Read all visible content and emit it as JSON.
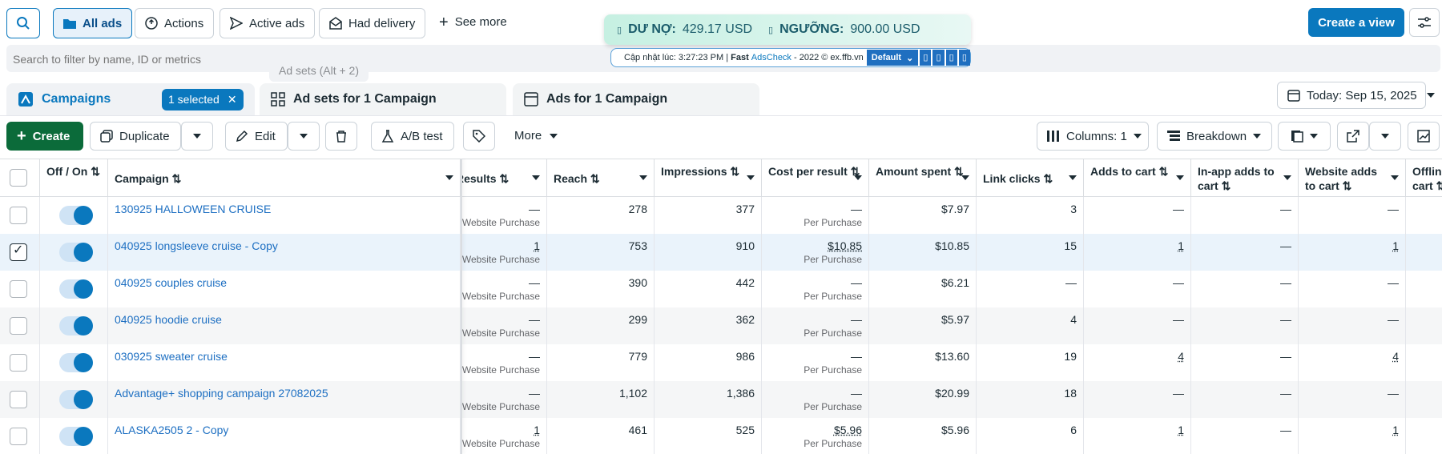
{
  "toolbar": {
    "all_ads": "All ads",
    "actions": "Actions",
    "active_ads": "Active ads",
    "had_delivery": "Had delivery",
    "see_more": "See more",
    "create_view": "Create a view"
  },
  "search": {
    "placeholder": "Search to filter by name, ID or metrics"
  },
  "tooltip": "Ad sets (Alt + 2)",
  "adscheck": {
    "debt_label": "DƯ NỢ:",
    "debt_value": "429.17 USD",
    "threshold_label": "NGƯỠNG:",
    "threshold_value": "900.00 USD",
    "updated": "Cập nhật lúc: 3:27:23 PM | ",
    "fast": "Fast ",
    "brand": "AdsCheck",
    "footer": " - 2022 © ex.ffb.vn",
    "select": "Default"
  },
  "tabs": {
    "campaigns": "Campaigns",
    "selected": "1 selected",
    "adsets": "Ad sets for 1 Campaign",
    "ads": "Ads for 1 Campaign"
  },
  "date": "Today: Sep 15, 2025",
  "actions": {
    "create": "Create",
    "duplicate": "Duplicate",
    "edit": "Edit",
    "ab": "A/B test",
    "more": "More",
    "columns": "Columns: 1",
    "breakdown": "Breakdown"
  },
  "headers": {
    "offon": "Off / On ⇅",
    "campaign": "Campaign ⇅",
    "results": "Results ⇅",
    "reach": "Reach ⇅",
    "impressions": "Impressions ⇅",
    "cpr": "Cost per result ⇅",
    "amount": "Amount spent ⇅",
    "clicks": "Link clicks ⇅",
    "atc": "Adds to cart ⇅",
    "inapp": "In-app adds to cart ⇅",
    "web": "Website adds to cart ⇅",
    "offline": "Offline adds to cart ⇅"
  },
  "rows": [
    {
      "name": "130925 HALLOWEEN CRUISE",
      "results": "—",
      "rsub": "Website Purchase",
      "reach": "278",
      "imp": "377",
      "cpr": "—",
      "csub": "Per Purchase",
      "amount": "$7.97",
      "clicks": "3",
      "atc": "—",
      "inapp": "—",
      "web": "—"
    },
    {
      "name": "040925 longsleeve cruise - Copy",
      "results": "1",
      "rsub": "Website Purchase",
      "reach": "753",
      "imp": "910",
      "cpr": "$10.85",
      "csub": "Per Purchase",
      "amount": "$10.85",
      "clicks": "15",
      "atc": "1",
      "inapp": "—",
      "web": "1"
    },
    {
      "name": "040925 couples cruise",
      "results": "—",
      "rsub": "Website Purchase",
      "reach": "390",
      "imp": "442",
      "cpr": "—",
      "csub": "Per Purchase",
      "amount": "$6.21",
      "clicks": "—",
      "atc": "—",
      "inapp": "—",
      "web": "—"
    },
    {
      "name": "040925 hoodie cruise",
      "results": "—",
      "rsub": "Website Purchase",
      "reach": "299",
      "imp": "362",
      "cpr": "—",
      "csub": "Per Purchase",
      "amount": "$5.97",
      "clicks": "4",
      "atc": "—",
      "inapp": "—",
      "web": "—"
    },
    {
      "name": "030925 sweater cruise",
      "results": "—",
      "rsub": "Website Purchase",
      "reach": "779",
      "imp": "986",
      "cpr": "—",
      "csub": "Per Purchase",
      "amount": "$13.60",
      "clicks": "19",
      "atc": "4",
      "inapp": "—",
      "web": "4"
    },
    {
      "name": "Advantage+ shopping campaign 27082025",
      "results": "—",
      "rsub": "Website Purchase",
      "reach": "1,102",
      "imp": "1,386",
      "cpr": "—",
      "csub": "Per Purchase",
      "amount": "$20.99",
      "clicks": "18",
      "atc": "—",
      "inapp": "—",
      "web": "—"
    },
    {
      "name": "ALASKA2505 2 - Copy",
      "results": "1",
      "rsub": "Website Purchase",
      "reach": "461",
      "imp": "525",
      "cpr": "$5.96",
      "csub": "Per Purchase",
      "amount": "$5.96",
      "clicks": "6",
      "atc": "1",
      "inapp": "—",
      "web": "1"
    }
  ]
}
